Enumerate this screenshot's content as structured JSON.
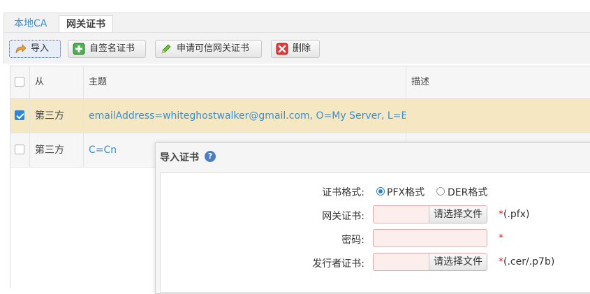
{
  "tabs": [
    {
      "label": "本地CA",
      "active": false
    },
    {
      "label": "网关证书",
      "active": true
    }
  ],
  "toolbar": {
    "import_label": "导入",
    "selfsign_label": "自签名证书",
    "apply_label": "申请可信网关证书",
    "delete_label": "删除"
  },
  "table": {
    "columns": [
      "从",
      "主题",
      "描述"
    ],
    "rows": [
      {
        "checked": true,
        "from": "第三方",
        "subject": "emailAddress=whiteghostwalker@gmail.com, O=My Server, L=BJ, S",
        "desc": ""
      },
      {
        "checked": false,
        "from": "第三方",
        "subject": "C=Cn",
        "desc": ""
      }
    ]
  },
  "dialog": {
    "title": "导入证书",
    "help_icon": "?",
    "format_label": "证书格式:",
    "format_options": [
      "PFX格式",
      "DER格式"
    ],
    "format_selected": "PFX格式",
    "gateway_cert_label": "网关证书:",
    "issuer_cert_label": "发行者证书:",
    "password_label": "密码:",
    "choose_file_label": "请选择文件",
    "gateway_hint": "(.pfx)",
    "issuer_hint": "(.cer/.p7b)",
    "required_mark": "*"
  },
  "colors": {
    "accent": "#3a8fd1",
    "selected_row": "#f4e7c1",
    "required": "#dd2222"
  }
}
